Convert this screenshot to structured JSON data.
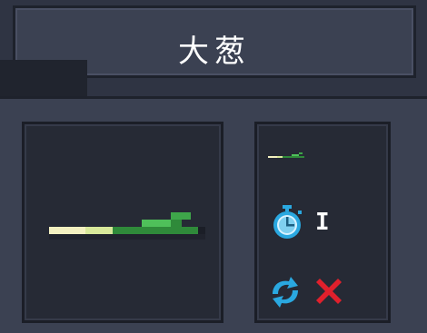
{
  "item": {
    "name": "大葱",
    "use_count": "I"
  },
  "icons": {
    "timer": "stopwatch-icon",
    "swap": "cycle-icon",
    "remove": "close-icon"
  },
  "colors": {
    "panel": "#3b4152",
    "inner": "#262a35",
    "accent_blue": "#2aa8e0",
    "close_red": "#e0202c",
    "leek_white": "#f3f0c0",
    "leek_green": "#3ea64a"
  }
}
